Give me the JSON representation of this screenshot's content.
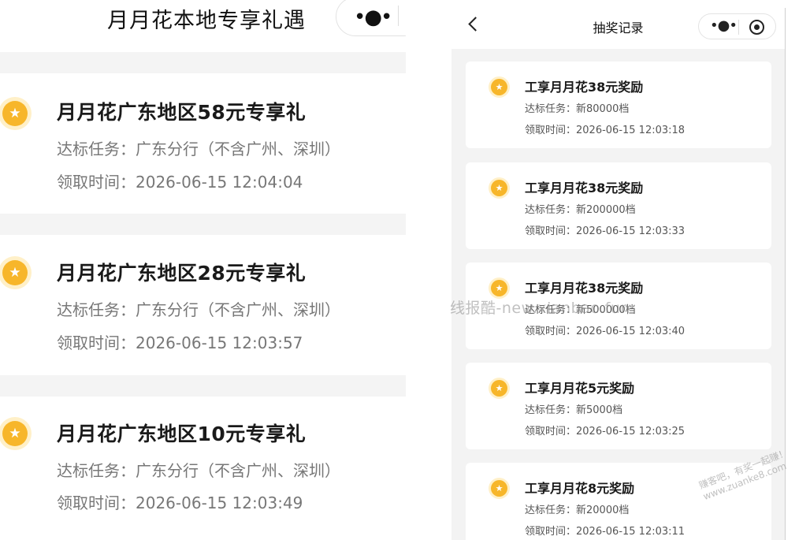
{
  "left": {
    "title": "月月花本地专享礼遇",
    "capsule_dots": "•●•",
    "cards": [
      {
        "title": "月月花广东地区58元专享礼",
        "task": "达标任务：广东分行（不含广州、深圳）",
        "time": "领取时间：2026-06-15 12:04:04"
      },
      {
        "title": "月月花广东地区28元专享礼",
        "task": "达标任务：广东分行（不含广州、深圳）",
        "time": "领取时间：2026-06-15 12:03:57"
      },
      {
        "title": "月月花广东地区10元专享礼",
        "task": "达标任务：广东分行（不含广州、深圳）",
        "time": "领取时间：2026-06-15 12:03:49"
      }
    ]
  },
  "right": {
    "title": "抽奖记录",
    "capsule_dots": "•●•",
    "cards": [
      {
        "title": "工享月月花38元奖励",
        "task": "达标任务：新80000档",
        "time": "领取时间：2026-06-15 12:03:18"
      },
      {
        "title": "工享月月花38元奖励",
        "task": "达标任务：新200000档",
        "time": "领取时间：2026-06-15 12:03:33"
      },
      {
        "title": "工享月月花38元奖励",
        "task": "达标任务：新500000档",
        "time": "领取时间：2026-06-15 12:03:40"
      },
      {
        "title": "工享月月花5元奖励",
        "task": "达标任务：新5000档",
        "time": "领取时间：2026-06-15 12:03:25"
      },
      {
        "title": "工享月月花8元奖励",
        "task": "达标任务：新20000档",
        "time": "领取时间：2026-06-15 12:03:11"
      }
    ]
  },
  "icons": {
    "coin": "star-coin-icon",
    "back": "chevron-left-icon",
    "more": "more-dots-icon",
    "close": "target-circle-icon"
  },
  "colors": {
    "coin": "#f7b62a",
    "coin_ring": "#fff0c8",
    "page_bg": "#f3f3f3"
  },
  "watermarks": {
    "center": "线报酷-new.xianbao.fun",
    "corner_line1": "赚客吧，有奖一起赚！",
    "corner_line2": "www.zuanke8.com"
  }
}
